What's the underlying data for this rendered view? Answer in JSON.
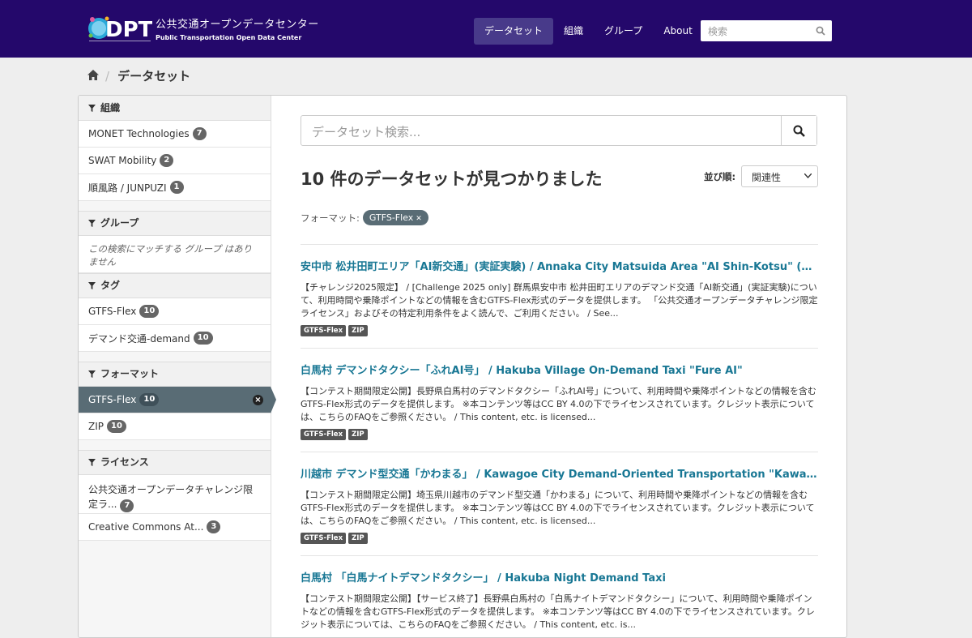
{
  "header": {
    "logo_jp": "公共交通オープンデータセンター",
    "logo_en": "Public Transportation Open Data Center",
    "nav": [
      "データセット",
      "組織",
      "グループ",
      "About"
    ],
    "search_placeholder": "検索"
  },
  "breadcrumb": {
    "current": "データセット"
  },
  "sidebar": {
    "organizations": {
      "title": "組織",
      "items": [
        {
          "label": "MONET Technologies",
          "count": "7"
        },
        {
          "label": "SWAT Mobility",
          "count": "2"
        },
        {
          "label": "順風路 / JUNPUZI",
          "count": "1"
        }
      ]
    },
    "groups": {
      "title": "グループ",
      "empty": "この検索にマッチする グループ はありません"
    },
    "tags": {
      "title": "タグ",
      "items": [
        {
          "label": "GTFS-Flex",
          "count": "10"
        },
        {
          "label": "デマンド交通-demand",
          "count": "10"
        }
      ]
    },
    "formats": {
      "title": "フォーマット",
      "items": [
        {
          "label": "GTFS-Flex",
          "count": "10"
        },
        {
          "label": "ZIP",
          "count": "10"
        }
      ]
    },
    "licenses": {
      "title": "ライセンス",
      "items": [
        {
          "label": "公共交通オープンデータチャレンジ限定ラ...",
          "count": "7"
        },
        {
          "label": "Creative Commons At...",
          "count": "3"
        }
      ]
    }
  },
  "main": {
    "search_placeholder": "データセット検索...",
    "result_count": "10 件のデータセットが見つかりました",
    "sort_label": "並び順:",
    "sort_value": "関連性",
    "filter_label": "フォーマット:",
    "filter_value": "GTFS-Flex",
    "datasets": [
      {
        "title": "安中市 松井田町エリア「AI新交通」(実証実験) / Annaka City Matsuida Area \"AI Shin-Kotsu\" (Experim...",
        "notes": "【チャレンジ2025限定】 / [Challenge 2025 only] 群馬県安中市 松井田町エリアのデマンド交通「AI新交通」(実証実験)について、利用時間や乗降ポイントなどの情報を含むGTFS-Flex形式のデータを提供します。 「公共交通オープンデータチャレンジ限定ライセンス」およびその特定利用条件をよく読んで、ご利用ください。 / See...",
        "formats": [
          "GTFS-Flex",
          "ZIP"
        ]
      },
      {
        "title": "白馬村 デマンドタクシー「ふれAI号」 / Hakuba Village On-Demand Taxi \"Fure AI\"",
        "notes": "【コンテスト期間限定公開】長野県白馬村のデマンドタクシー「ふれAI号」について、利用時間や乗降ポイントなどの情報を含むGTFS-Flex形式のデータを提供します。 ※本コンテンツ等はCC BY 4.0の下でライセンスされています。クレジット表示については、こちらのFAQをご参照ください。 / This content, etc. is licensed...",
        "formats": [
          "GTFS-Flex",
          "ZIP"
        ]
      },
      {
        "title": "川越市 デマンド型交通「かわまる」 / Kawagoe City Demand-Oriented Transportation \"Kawamaru\"",
        "notes": "【コンテスト期間限定公開】埼玉県川越市のデマンド型交通「かわまる」について、利用時間や乗降ポイントなどの情報を含むGTFS-Flex形式のデータを提供します。 ※本コンテンツ等はCC BY 4.0の下でライセンスされています。クレジット表示については、こちらのFAQをご参照ください。 / This content, etc. is licensed...",
        "formats": [
          "GTFS-Flex",
          "ZIP"
        ]
      },
      {
        "title": "白馬村 「白馬ナイトデマンドタクシー」 / Hakuba Night Demand Taxi",
        "notes": "【コンテスト期間限定公開】【サービス終了】長野県白馬村の「白馬ナイトデマンドタクシー」について、利用時間や乗降ポイントなどの情報を含むGTFS-Flex形式のデータを提供します。 ※本コンテンツ等はCC BY 4.0の下でライセンスされています。クレジット表示については、こちらのFAQをご参照ください。 / This content, etc. is...",
        "formats": []
      }
    ]
  }
}
